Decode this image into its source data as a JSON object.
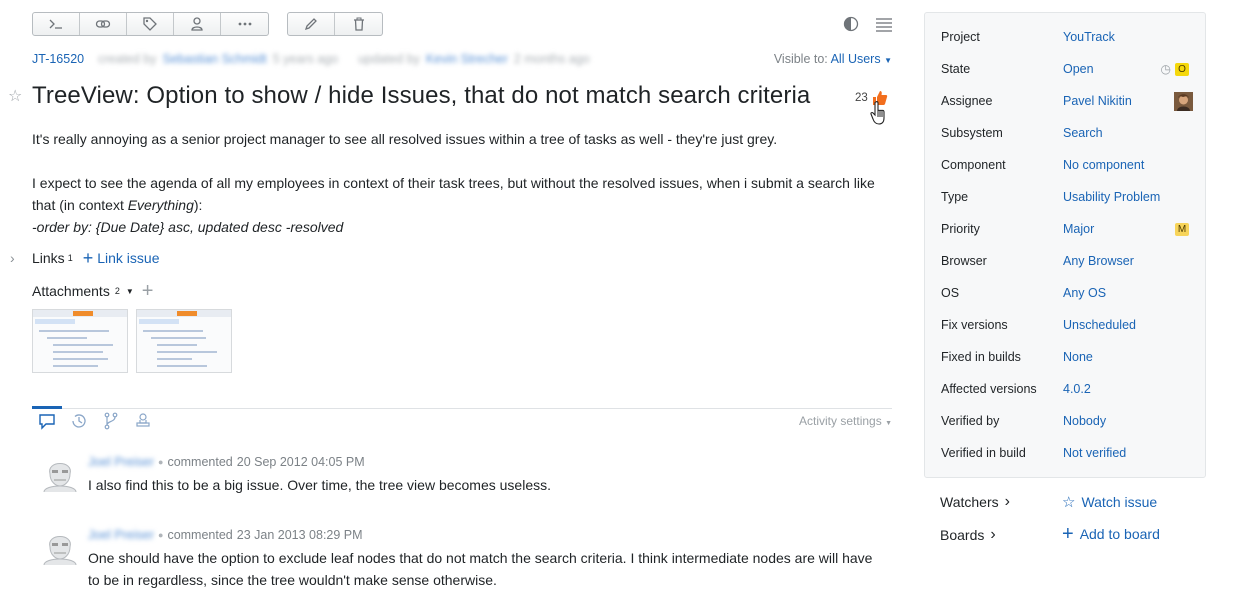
{
  "toolbar": {
    "buttons": [
      "command-icon",
      "link-icon",
      "tag-icon",
      "user-icon",
      "more-icon"
    ],
    "edit_buttons": [
      "pencil-icon",
      "trash-icon"
    ]
  },
  "issue": {
    "id": "JT-16520",
    "created_label": "created by",
    "created_by": "Sebastian Schmidt",
    "created_ago": "5 years ago",
    "updated_label": "updated by",
    "updated_by": "Kevin Strecher",
    "updated_ago": "2 months ago",
    "visible_label": "Visible to:",
    "visible_value": "All Users",
    "title": "TreeView: Option to show / hide Issues, that do not match search criteria",
    "votes": "23",
    "description": {
      "p1": "It's really annoying as a senior project manager to see all resolved issues within a tree of tasks as well - they're just grey.",
      "p2_a": "I expect to see the agenda of all my employees in context of their task trees, but without the resolved issues, when i submit a search like that (in context ",
      "p2_em": "Everything",
      "p2_b": "):",
      "p3": "-order by: {Due Date} asc, updated desc -resolved"
    },
    "links_label": "Links",
    "links_count": "1",
    "link_issue": "Link issue",
    "attachments_label": "Attachments",
    "attachments_count": "2"
  },
  "activity": {
    "settings_label": "Activity settings",
    "tabs": [
      "comments-tab-icon",
      "history-tab-icon",
      "vcs-tab-icon",
      "work-tab-icon"
    ],
    "comments": [
      {
        "author": "Joel Preiser",
        "action": "commented",
        "date": "20 Sep 2012 04:05 PM",
        "text": "I also find this to be a big issue. Over time, the tree view becomes useless."
      },
      {
        "author": "Joel Preiser",
        "action": "commented",
        "date": "23 Jan 2013 08:29 PM",
        "text": "One should have the option to exclude leaf nodes that do not match the search criteria. I think intermediate nodes are will have to be in regardless, since the tree wouldn't make sense otherwise."
      }
    ]
  },
  "fields": [
    {
      "label": "Project",
      "value": "YouTrack"
    },
    {
      "label": "State",
      "value": "Open",
      "badge": "O",
      "badge_color": "#f5d80c"
    },
    {
      "label": "Assignee",
      "value": "Pavel Nikitin"
    },
    {
      "label": "Subsystem",
      "value": "Search"
    },
    {
      "label": "Component",
      "value": "No component"
    },
    {
      "label": "Type",
      "value": "Usability Problem"
    },
    {
      "label": "Priority",
      "value": "Major",
      "badge": "M",
      "badge_color": "#f7d45a"
    },
    {
      "label": "Browser",
      "value": "Any Browser"
    },
    {
      "label": "OS",
      "value": "Any OS"
    },
    {
      "label": "Fix versions",
      "value": "Unscheduled"
    },
    {
      "label": "Fixed in builds",
      "value": "None"
    },
    {
      "label": "Affected versions",
      "value": "4.0.2"
    },
    {
      "label": "Verified by",
      "value": "Nobody"
    },
    {
      "label": "Verified in build",
      "value": "Not verified"
    }
  ],
  "watchers": {
    "label": "Watchers",
    "action": "Watch issue"
  },
  "boards": {
    "label": "Boards",
    "action": "Add to board"
  },
  "colors": {
    "accent": "#1a64b5",
    "vote": "#f26e1d"
  }
}
